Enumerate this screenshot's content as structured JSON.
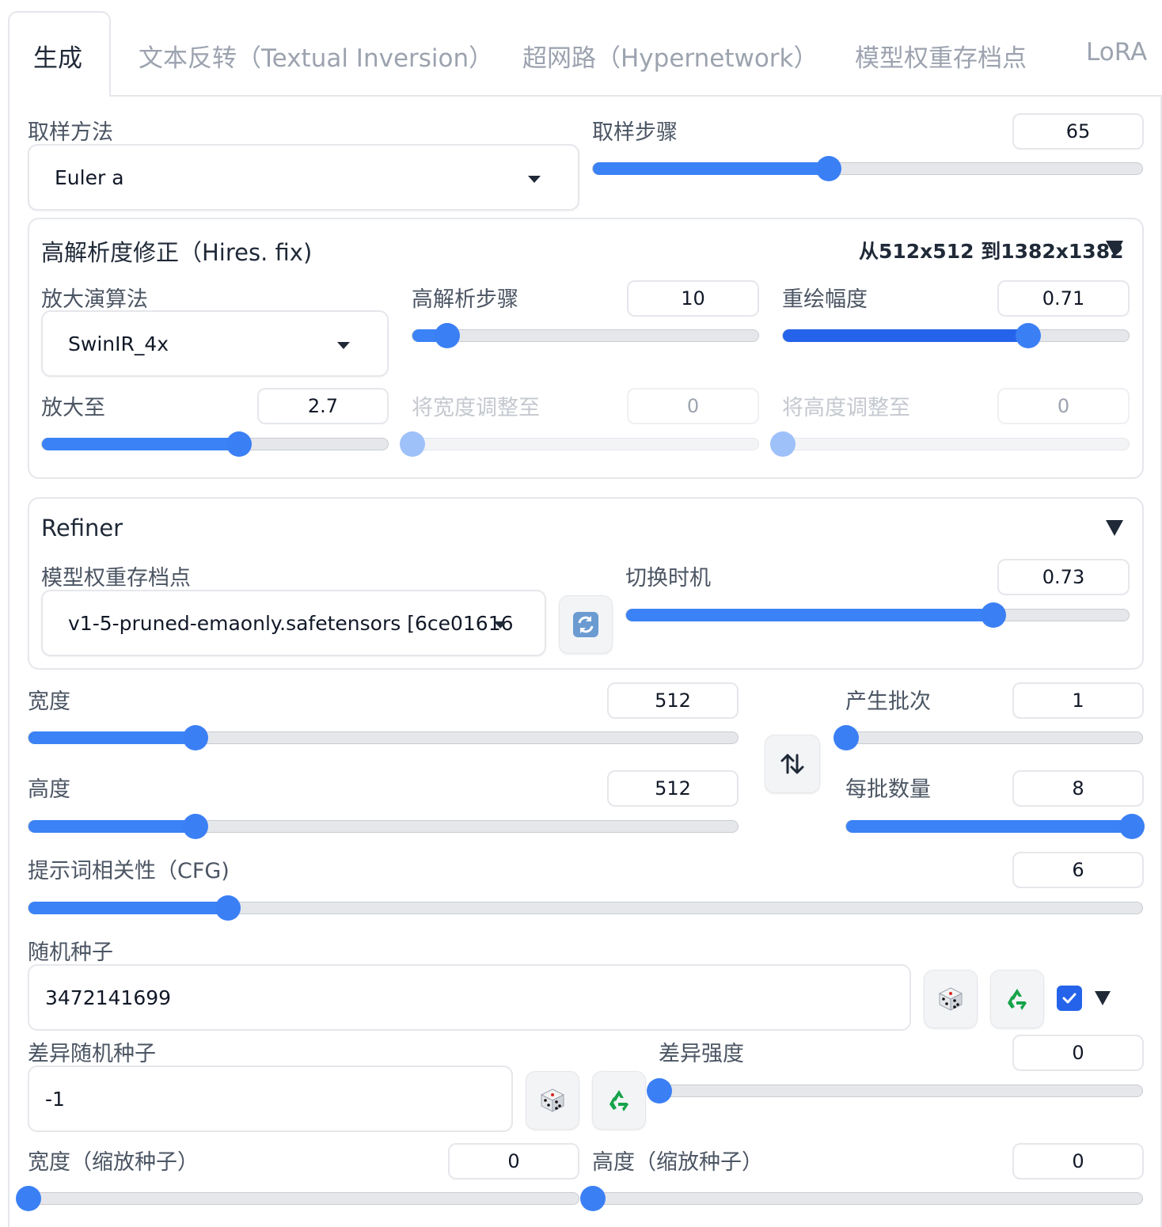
{
  "tabs": [
    "生成",
    "文本反转（Textual Inversion）",
    "超网路（Hypernetwork）",
    "模型权重存档点",
    "LoRA"
  ],
  "sampler": {
    "label": "取样方法",
    "value": "Euler a"
  },
  "steps": {
    "label": "取样步骤",
    "value": "65",
    "fraction": 0.43
  },
  "hires": {
    "title": "高解析度修正（Hires. fix)",
    "summary": "从512x512 到1382x1382",
    "upscaler": {
      "label": "放大演算法",
      "value": "SwinIR_4x"
    },
    "hires_steps": {
      "label": "高解析步骤",
      "value": "10",
      "fraction": 0.1
    },
    "denoise": {
      "label": "重绘幅度",
      "value": "0.71",
      "fraction": 0.71
    },
    "upscale_by": {
      "label": "放大至",
      "value": "2.7",
      "fraction": 0.57
    },
    "resize_width": {
      "label": "将宽度调整至",
      "value": "0"
    },
    "resize_height": {
      "label": "将高度调整至",
      "value": "0"
    }
  },
  "refiner": {
    "title": "Refiner",
    "checkpoint": {
      "label": "模型权重存档点",
      "value": "v1-5-pruned-emaonly.safetensors [6ce01616"
    },
    "switch_at": {
      "label": "切换时机",
      "value": "0.73",
      "fraction": 0.73
    }
  },
  "width": {
    "label": "宽度",
    "value": "512",
    "fraction": 0.235
  },
  "height": {
    "label": "高度",
    "value": "512",
    "fraction": 0.235
  },
  "batch_count": {
    "label": "产生批次",
    "value": "1",
    "fraction": 0.0
  },
  "batch_size": {
    "label": "每批数量",
    "value": "8",
    "fraction": 1.0
  },
  "cfg": {
    "label": "提示词相关性（CFG)",
    "value": "6",
    "fraction": 0.179
  },
  "seed": {
    "label": "随机种子",
    "value": "3472141699"
  },
  "variation_seed": {
    "label": "差异随机种子",
    "value": "-1"
  },
  "variation_strength": {
    "label": "差异强度",
    "value": "0",
    "fraction": 0
  },
  "seed_resize_width": {
    "label": "宽度（缩放种子）",
    "value": "0"
  },
  "seed_resize_height": {
    "label": "高度（缩放种子）",
    "value": "0"
  },
  "icons": {
    "dice": "dice-icon",
    "recycle": "recycle-icon",
    "refresh": "refresh-icon",
    "swap": "swap-vertical-icon",
    "checkmark": "checkmark-icon"
  },
  "colors": {
    "accent": "#3b82f6",
    "border": "#e5e7eb",
    "track": "#e5e7eb"
  }
}
